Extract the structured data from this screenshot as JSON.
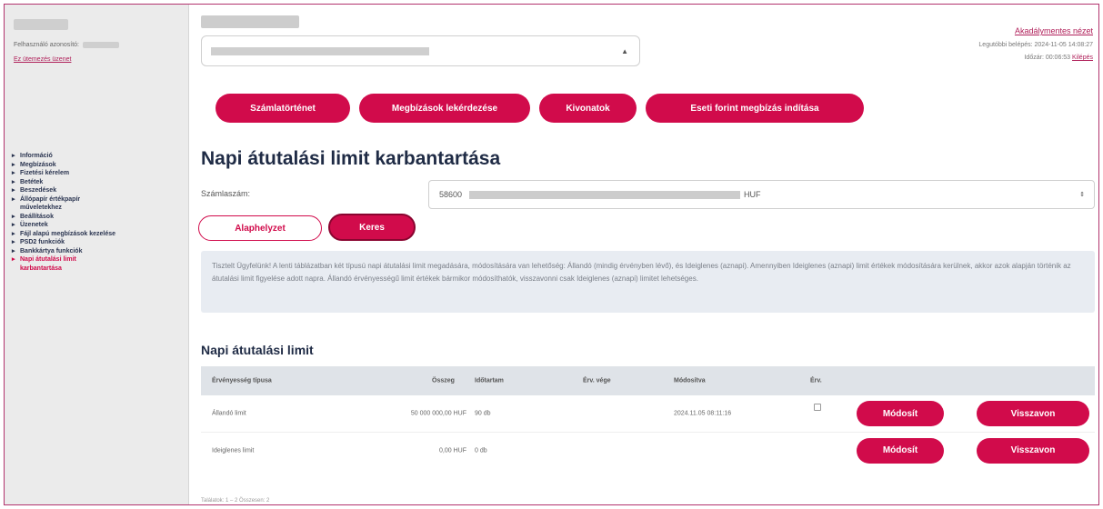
{
  "sidebar": {
    "user_label": "Felhasználó azonosító:",
    "link": "Ez ütemezés üzenet",
    "nav": [
      {
        "label": "Információ",
        "active": false
      },
      {
        "label": "Megbízások",
        "active": false
      },
      {
        "label": "Fizetési kérelem",
        "active": false
      },
      {
        "label": "Betétek",
        "active": false
      },
      {
        "label": "Beszedések",
        "active": false
      },
      {
        "label": "Állópapír értékpapír",
        "active": false
      },
      {
        "label": "műveletekhez",
        "active": false,
        "continuation": true
      },
      {
        "label": "Beállítások",
        "active": false
      },
      {
        "label": "Üzenetek",
        "active": false
      },
      {
        "label": "Fájl alapú megbízások kezelése",
        "active": false
      },
      {
        "label": "PSD2 funkciók",
        "active": false
      },
      {
        "label": "Bankkártya funkciók",
        "active": false
      },
      {
        "label": "Napi átutalási limit",
        "active": true
      },
      {
        "label": "karbantartása",
        "active": true,
        "continuation": true
      }
    ]
  },
  "header": {
    "accessible_view": "Akadálymentes nézet",
    "last_login": "Legutóbbi belépés: 2024-11-05 14:08:27",
    "timer_label": "Időzár: 00:06:53",
    "logout": "Kilépés"
  },
  "actions": [
    {
      "label": "Számlatörténet",
      "name": "account-history-button",
      "w": 148
    },
    {
      "label": "Megbízások lekérdezése",
      "name": "orders-query-button",
      "w": 188
    },
    {
      "label": "Kivonatok",
      "name": "statements-button",
      "w": 107
    },
    {
      "label": "Eseti forint megbízás indítása",
      "name": "new-huf-transfer-button",
      "w": 240
    }
  ],
  "page_title": "Napi átutalási limit karbantartása",
  "form": {
    "account_label": "Számlaszám:",
    "account_prefix": "58600",
    "account_currency": "HUF",
    "reset_label": "Alaphelyzet",
    "search_label": "Keres"
  },
  "info_text": "Tisztelt Ügyfelünk! A lenti táblázatban két típusú napi átutalási limit megadására, módosítására van lehetőség: Állandó (mindig érvényben lévő), és Ideiglenes (aznapi). Amennyiben Ideiglenes (aznapi) limit értékek módosítására kerülnek, akkor azok alapján történik az átutalási limit figyelése adott napra. Állandó érvényességű limit értékek bármikor módosíthatók, visszavonni csak Ideiglenes (aznapi) limitet lehetséges.",
  "table": {
    "title": "Napi átutalási limit",
    "headers": {
      "type": "Érvényesség típusa",
      "amount": "Összeg",
      "duration": "Időtartam",
      "valid_until": "Érv. vége",
      "modified": "Módosítva",
      "valid": "Érv."
    },
    "rows": [
      {
        "type": "Állandó limit",
        "amount": "50 000 000,00 HUF",
        "duration": "90 db",
        "valid_until": "",
        "modified": "2024.11.05 08:11:16",
        "has_checkbox": true,
        "modify": "Módosít",
        "revoke": "Visszavon"
      },
      {
        "type": "Ideiglenes limit",
        "amount": "0,00 HUF",
        "duration": "0 db",
        "valid_until": "",
        "modified": "",
        "has_checkbox": false,
        "modify": "Módosít",
        "revoke": "Visszavon"
      }
    ]
  },
  "footer": "Találatok: 1 – 2 Összesen: 2",
  "colors": {
    "accent": "#d10b4b",
    "navy": "#1f2b45",
    "info_bg": "#e8ecf2"
  }
}
